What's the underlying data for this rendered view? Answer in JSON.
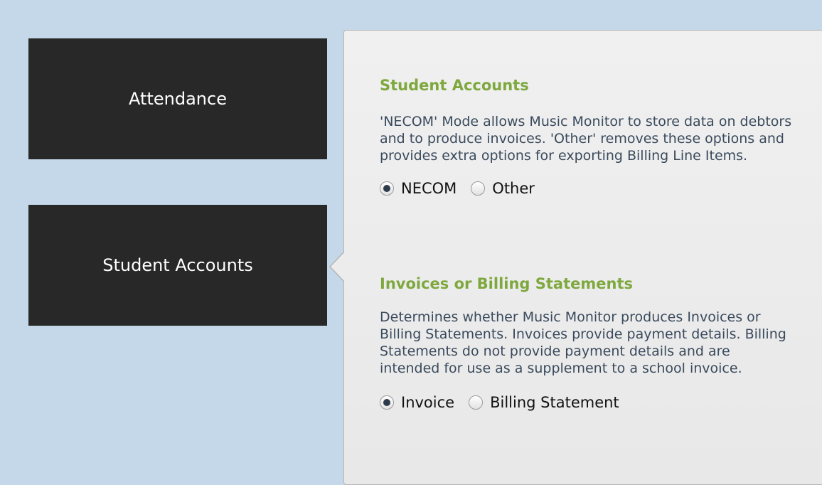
{
  "nav": {
    "attendance_label": "Attendance",
    "accounts_label": "Student Accounts"
  },
  "sections": [
    {
      "title": "Student Accounts",
      "description": "'NECOM' Mode allows Music Monitor to store data on debtors and to produce invoices. 'Other' removes these options and provides extra options for exporting Billing Line Items.",
      "options": [
        {
          "label": "NECOM",
          "checked": true
        },
        {
          "label": "Other",
          "checked": false
        }
      ]
    },
    {
      "title": "Invoices or Billing Statements",
      "description": "Determines whether Music Monitor produces Invoices or Billing Statements. Invoices provide payment details. Billing Statements do not provide payment details and are intended for use as a supplement to a school invoice.",
      "options": [
        {
          "label": "Invoice",
          "checked": true
        },
        {
          "label": "Billing Statement",
          "checked": false
        }
      ]
    }
  ],
  "colors": {
    "background": "#c4d8ea",
    "tile": "#282828",
    "section_title": "#7ea83e",
    "description_text": "#3a4a5c"
  }
}
